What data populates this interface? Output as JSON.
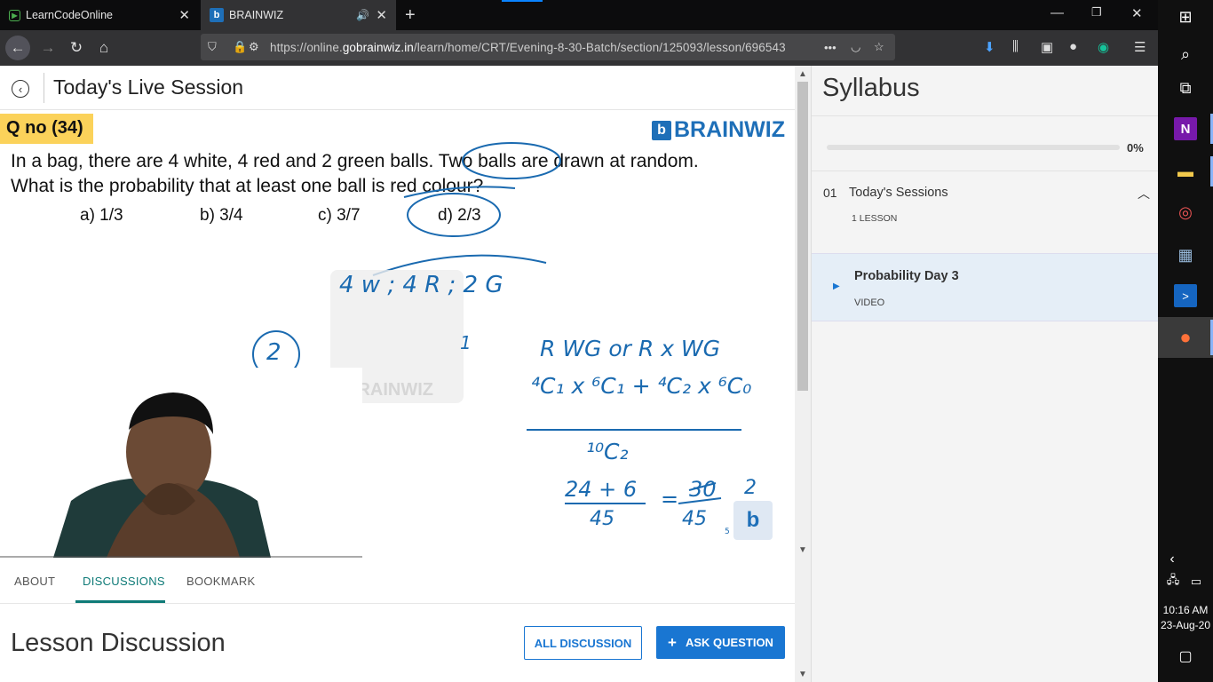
{
  "browser": {
    "tabs": [
      {
        "title": "LearnCodeOnline",
        "favicon": "play-icon"
      },
      {
        "title": "BRAINWIZ",
        "favicon": "brainwiz-logo-icon"
      }
    ],
    "new_tab_label": "+",
    "window_controls": {
      "minimize": "—",
      "maximize": "❐",
      "close": "✕"
    },
    "url_prefix": "https://online.",
    "url_host": "gobrainwiz.in",
    "url_path": "/learn/home/CRT/Evening-8-30-Batch/section/125093/lesson/696543",
    "url_more": "•••"
  },
  "page": {
    "title": "Today's Live Session",
    "back_icon": "‹",
    "video": {
      "question_label": "Q no (34)",
      "brand": "BRAINWIZ",
      "brand_mark": "b",
      "question_line1": "In a bag, there are 4 white, 4 red and 2 green balls. Two balls are drawn at random.",
      "question_line2": "What is the probability that at least one ball is red colour?",
      "options": [
        "a) 1/3",
        "b)  3/4",
        "c) 3/7",
        "d) 2/3"
      ],
      "watermark": "BRAINWIZ",
      "handwriting": {
        "ratio": "4 w ; 4 R ; 2 G",
        "circle_num": "2",
        "one": "1",
        "expr1": "R  WG  or  R x WG",
        "expr2": "⁴C₁ x ⁶C₁ + ⁴C₂ x ⁶C₀",
        "denominator": "¹⁰C₂",
        "calc_numer": "24 + 6",
        "calc_denom": "45",
        "equals": "=",
        "result_numer": "30",
        "result_denom": "45",
        "result_small": "2",
        "corner_num": "5"
      }
    },
    "tabs": [
      "ABOUT",
      "DISCUSSIONS",
      "BOOKMARK"
    ],
    "active_tab": "DISCUSSIONS",
    "discussion_title": "Lesson Discussion",
    "all_discussion_label": "ALL DISCUSSION",
    "ask_question_label": "ASK QUESTION",
    "ask_question_icon": "+"
  },
  "syllabus": {
    "title": "Syllabus",
    "progress": 0,
    "progress_label": "0%",
    "section_number": "01",
    "section_name": "Today's Sessions",
    "section_count": "1 LESSON",
    "lesson_name": "Probability Day 3",
    "lesson_type": "VIDEO"
  },
  "taskbar": {
    "time": "10:16 AM",
    "date": "23-Aug-20"
  },
  "colors": {
    "accent": "#1976d2",
    "tab_active": "#0e7a77",
    "question_badge": "#fbd25a",
    "handwriting": "#1a6ab0"
  }
}
